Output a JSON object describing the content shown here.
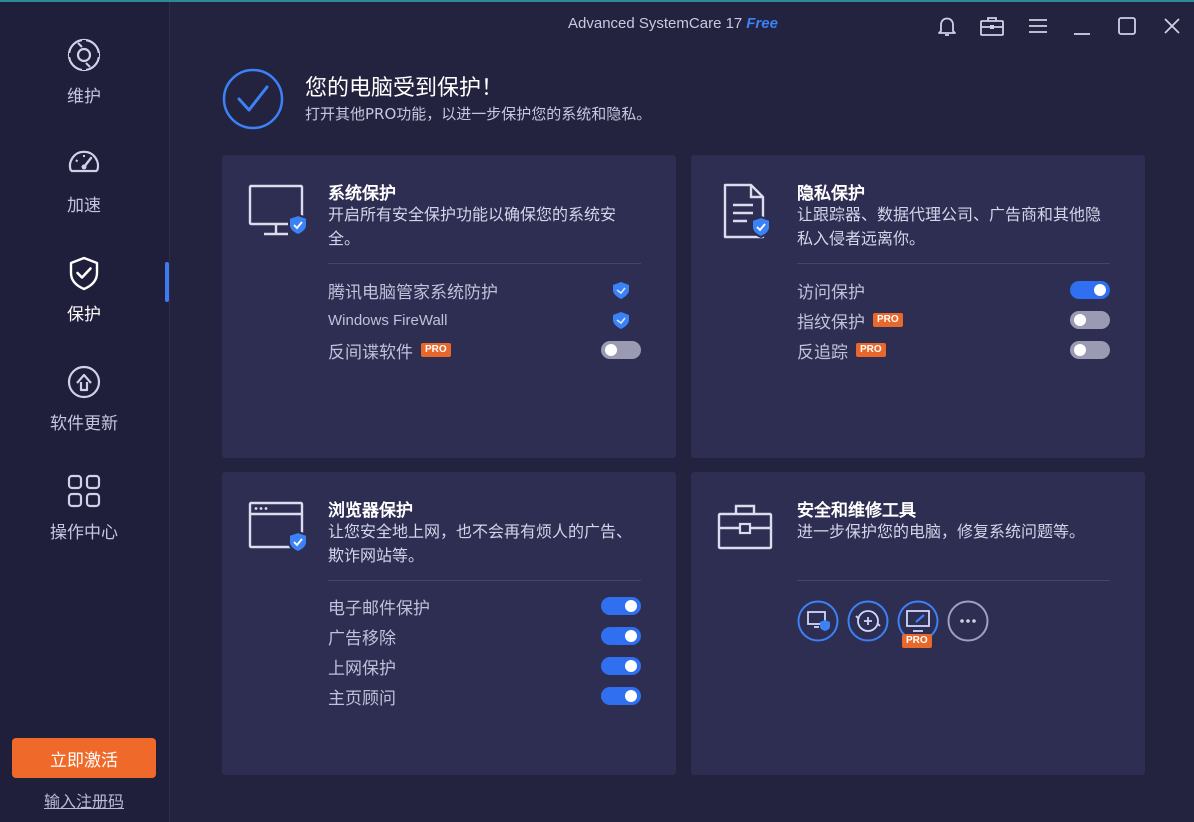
{
  "app": {
    "title": "Advanced SystemCare 17",
    "edition": "Free"
  },
  "sidebar": {
    "items": [
      {
        "label": "维护",
        "icon": "maintenance-icon"
      },
      {
        "label": "加速",
        "icon": "speedometer-icon"
      },
      {
        "label": "保护",
        "icon": "shield-check-icon",
        "active": true
      },
      {
        "label": "软件更新",
        "icon": "update-arrow-icon"
      },
      {
        "label": "操作中心",
        "icon": "grid-icon"
      }
    ],
    "activate_label": "立即激活",
    "register_label": "输入注册码"
  },
  "header": {
    "title": "您的电脑受到保护！",
    "subtitle": "打开其他PRO功能，以进一步保护您的系统和隐私。"
  },
  "cards": {
    "system": {
      "title": "系统保护",
      "desc": "开启所有安全保护功能以确保您的系统安全。",
      "rows": [
        {
          "label": "腾讯电脑管家系统防护",
          "control": "shield"
        },
        {
          "label": "Windows FireWall",
          "control": "shield"
        },
        {
          "label": "反间谍软件",
          "pro": "PRO",
          "control": "off"
        }
      ]
    },
    "privacy": {
      "title": "隐私保护",
      "desc": "让跟踪器、数据代理公司、广告商和其他隐私入侵者远离你。",
      "rows": [
        {
          "label": "访问保护",
          "control": "on"
        },
        {
          "label": "指纹保护",
          "pro": "PRO",
          "control": "off"
        },
        {
          "label": "反追踪",
          "pro": "PRO",
          "control": "off"
        }
      ]
    },
    "browser": {
      "title": "浏览器保护",
      "desc": "让您安全地上网，也不会再有烦人的广告、欺诈网站等。",
      "rows": [
        {
          "label": "电子邮件保护",
          "control": "on"
        },
        {
          "label": "广告移除",
          "control": "on"
        },
        {
          "label": "上网保护",
          "control": "on"
        },
        {
          "label": "主页顾问",
          "control": "on"
        }
      ]
    },
    "tools": {
      "title": "安全和维修工具",
      "desc": "进一步保护您的电脑，修复系统问题等。",
      "tool_pro": "PRO"
    }
  },
  "colors": {
    "accent": "#2f6ff0",
    "pro": "#e8672a",
    "card": "#2e2d52",
    "background": "#23223f"
  }
}
